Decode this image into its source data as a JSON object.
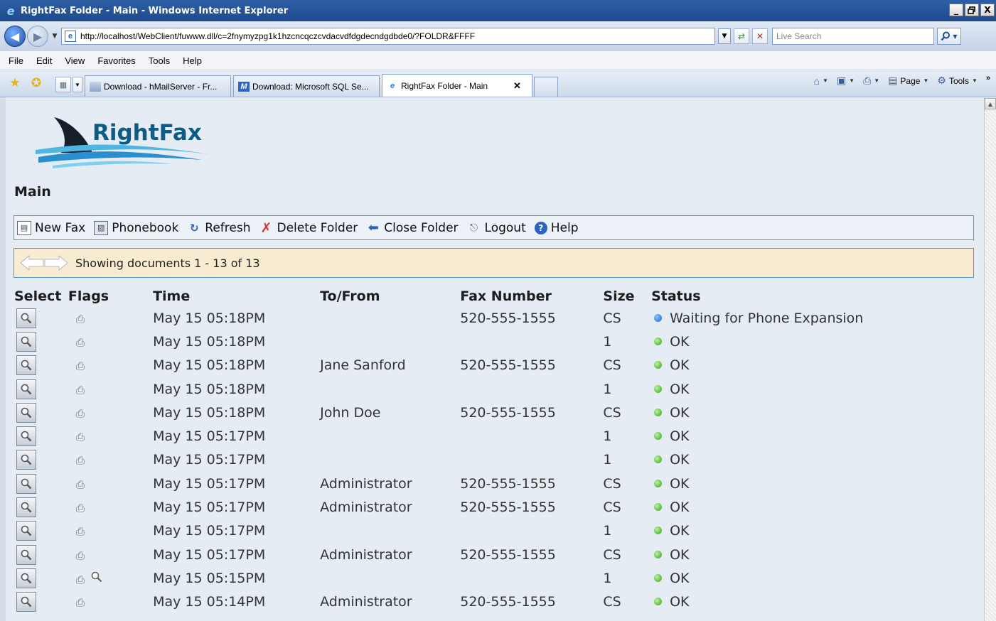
{
  "window": {
    "title": "RightFax Folder - Main - Windows Internet Explorer",
    "controls": [
      "_",
      " ",
      "X"
    ]
  },
  "address": {
    "url": "http://localhost/WebClient/fuwww.dll/c=2fnymyzpg1k1hzcncqczcvdacvdfdgdecndgdbde0/?FOLDR&FFFF",
    "search_placeholder": "Live Search"
  },
  "menu": [
    "File",
    "Edit",
    "View",
    "Favorites",
    "Tools",
    "Help"
  ],
  "tabs": [
    {
      "label": "Download - hMailServer - Fr..."
    },
    {
      "label": "Download: Microsoft SQL Se..."
    },
    {
      "label": "RightFax Folder - Main"
    }
  ],
  "command_bar": {
    "page": "Page",
    "tools": "Tools"
  },
  "app": {
    "logo_text": "RightFax",
    "page_title": "Main"
  },
  "toolbar": {
    "new_fax": "New Fax",
    "phonebook": "Phonebook",
    "refresh": "Refresh",
    "delete_folder": "Delete Folder",
    "close_folder": "Close Folder",
    "logout": "Logout",
    "help": "Help"
  },
  "pager": {
    "text": "Showing documents 1 - 13 of 13"
  },
  "columns": {
    "select": "Select",
    "flags": "Flags",
    "time": "Time",
    "to_from": "To/From",
    "fax_number": "Fax Number",
    "size": "Size",
    "status": "Status"
  },
  "status_colors": {
    "waiting": "#1d5fc8",
    "ok": "#3a9d1f"
  },
  "rows": [
    {
      "time": "May 15 05:18PM",
      "to_from": "",
      "fax": "520-555-1555",
      "size": "CS",
      "status": "Waiting for Phone Expansion",
      "status_kind": "waiting",
      "extra_flag": false
    },
    {
      "time": "May 15 05:18PM",
      "to_from": "",
      "fax": "",
      "size": "1",
      "status": "OK",
      "status_kind": "ok",
      "extra_flag": false
    },
    {
      "time": "May 15 05:18PM",
      "to_from": "Jane Sanford",
      "fax": "520-555-1555",
      "size": "CS",
      "status": "OK",
      "status_kind": "ok",
      "extra_flag": false
    },
    {
      "time": "May 15 05:18PM",
      "to_from": "",
      "fax": "",
      "size": "1",
      "status": "OK",
      "status_kind": "ok",
      "extra_flag": false
    },
    {
      "time": "May 15 05:18PM",
      "to_from": "John Doe",
      "fax": "520-555-1555",
      "size": "CS",
      "status": "OK",
      "status_kind": "ok",
      "extra_flag": false
    },
    {
      "time": "May 15 05:17PM",
      "to_from": "",
      "fax": "",
      "size": "1",
      "status": "OK",
      "status_kind": "ok",
      "extra_flag": false
    },
    {
      "time": "May 15 05:17PM",
      "to_from": "",
      "fax": "",
      "size": "1",
      "status": "OK",
      "status_kind": "ok",
      "extra_flag": false
    },
    {
      "time": "May 15 05:17PM",
      "to_from": "Administrator",
      "fax": "520-555-1555",
      "size": "CS",
      "status": "OK",
      "status_kind": "ok",
      "extra_flag": false
    },
    {
      "time": "May 15 05:17PM",
      "to_from": "Administrator",
      "fax": "520-555-1555",
      "size": "CS",
      "status": "OK",
      "status_kind": "ok",
      "extra_flag": false
    },
    {
      "time": "May 15 05:17PM",
      "to_from": "",
      "fax": "",
      "size": "1",
      "status": "OK",
      "status_kind": "ok",
      "extra_flag": false
    },
    {
      "time": "May 15 05:17PM",
      "to_from": "Administrator",
      "fax": "520-555-1555",
      "size": "CS",
      "status": "OK",
      "status_kind": "ok",
      "extra_flag": false
    },
    {
      "time": "May 15 05:15PM",
      "to_from": "",
      "fax": "",
      "size": "1",
      "status": "OK",
      "status_kind": "ok",
      "extra_flag": true
    },
    {
      "time": "May 15 05:14PM",
      "to_from": "Administrator",
      "fax": "520-555-1555",
      "size": "CS",
      "status": "OK",
      "status_kind": "ok",
      "extra_flag": false
    }
  ]
}
